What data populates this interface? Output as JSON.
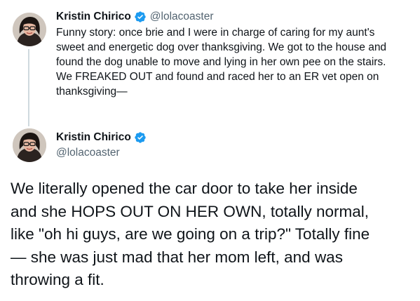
{
  "tweet_1": {
    "author_name": "Kristin Chirico",
    "handle": "@lolacoaster",
    "verified": true,
    "text": "Funny story: once brie and I were in charge of caring for my aunt's\nsweet and energetic dog over thanksgiving. We got to the house and\nfound the dog unable to move and lying in her own pee on the stairs.\nWe FREAKED OUT and found and raced her to an ER vet open on\nthanksgiving—"
  },
  "tweet_2": {
    "author_name": "Kristin Chirico",
    "handle": "@lolacoaster",
    "verified": true,
    "text": "We literally opened the car door to take her inside\nand she HOPS OUT ON HER OWN, totally normal,\nlike \"oh hi guys, are we going on a trip?\" Totally fine\n— she was just mad that her mom left, and was\nthrowing a fit."
  },
  "colors": {
    "verified_badge": "#1d9bf0",
    "handle_text": "#536471",
    "thread_line": "#cfd9de",
    "body_text": "#0f1419"
  },
  "icons": {
    "verified": "verified-badge-icon",
    "avatar": "profile-photo"
  }
}
